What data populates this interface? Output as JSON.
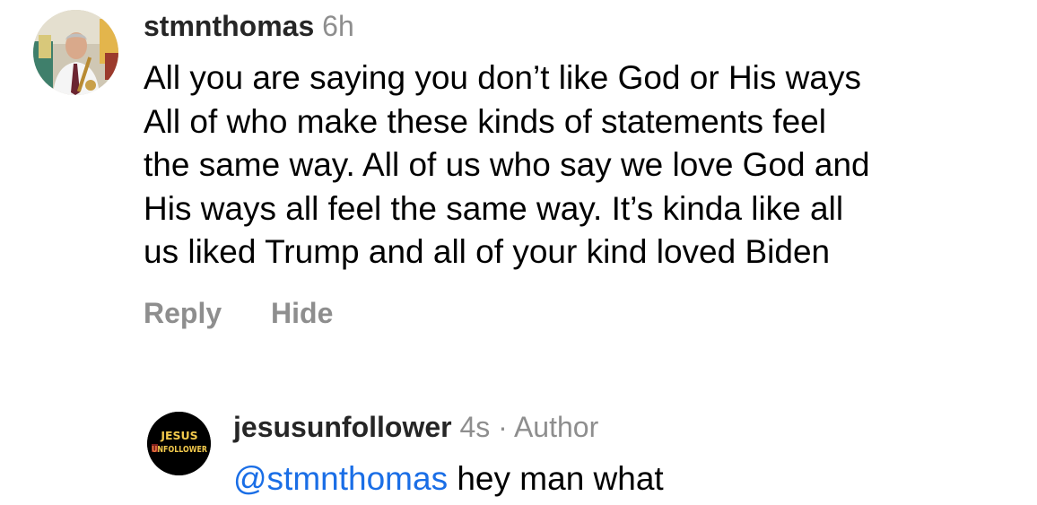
{
  "comment1": {
    "username": "stmnthomas",
    "time": "6h",
    "lines": [
      "All you are saying you don’t like God or His ways",
      "All of who make these kinds of statements feel",
      "the same way. All of us who say we love God and",
      "His ways all feel the same way. It’s kinda like all",
      "us liked Trump and all of your kind loved Biden"
    ],
    "actions": {
      "reply": "Reply",
      "hide": "Hide"
    }
  },
  "comment2": {
    "avatar_text": {
      "line1": "JESUS",
      "line2": "UNFOLLOWER"
    },
    "username": "jesusunfollower",
    "time": "4s",
    "separator": "·",
    "role": "Author",
    "mention": "@stmnthomas",
    "text": "hey man what"
  },
  "colors": {
    "meta": "#8e8e8e",
    "mention": "#1a6ee6",
    "avatar_red": "#e53935",
    "avatar_yellow": "#f2c94c"
  }
}
